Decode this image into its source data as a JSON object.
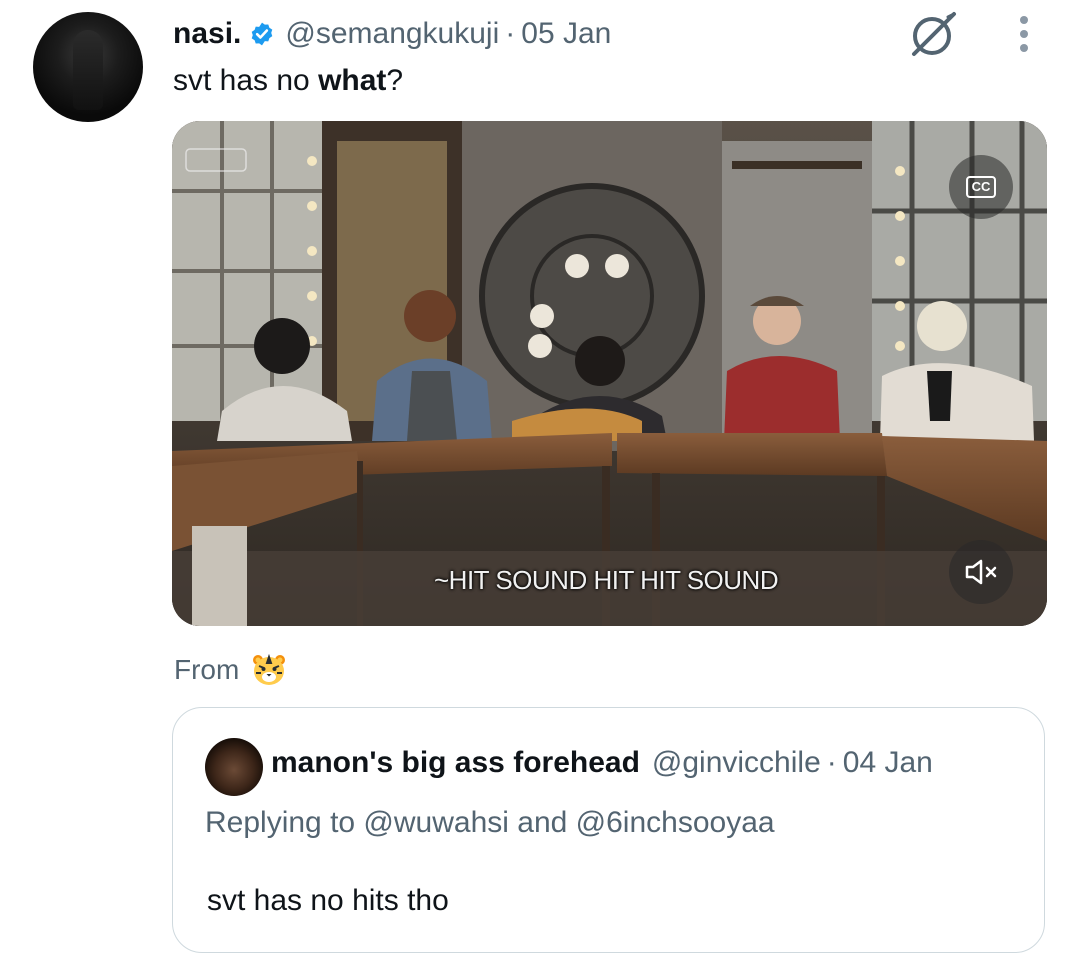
{
  "tweet": {
    "display_name": "nasi.",
    "handle": "@semangkukuji",
    "separator": "·",
    "date": "05 Jan",
    "text_prefix": "svt has no ",
    "text_bold": "what",
    "text_suffix": "?"
  },
  "media": {
    "cc_label": "CC",
    "subtitle": "~HIT SOUND HIT HIT SOUND"
  },
  "from": {
    "label": "From",
    "emoji_icon": "tiger-face-icon"
  },
  "quoted": {
    "display_name": "manon's big ass forehead",
    "handle": "@ginvicchile",
    "separator": "·",
    "date": "04 Jan",
    "replying_to": "Replying to @wuwahsi and @6inchsooyaa",
    "text": "svt has no hits tho"
  },
  "colors": {
    "verified_blue": "#1d9bf0",
    "secondary_text": "#536471",
    "border": "#cfd9de"
  }
}
